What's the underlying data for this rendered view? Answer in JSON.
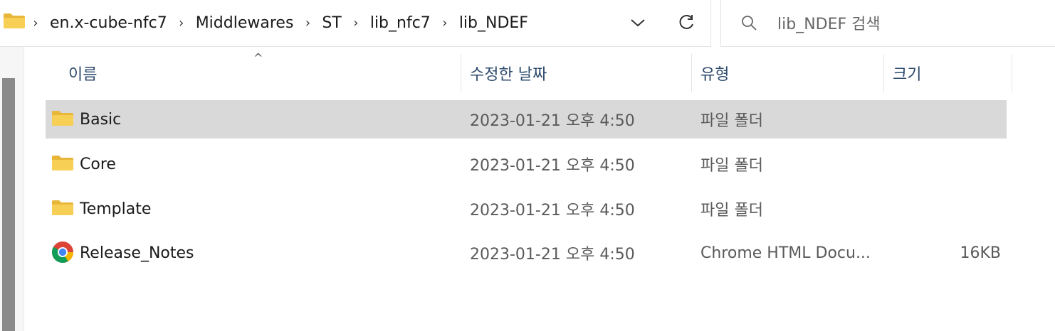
{
  "breadcrumb": [
    "en.x-cube-nfc7",
    "Middlewares",
    "ST",
    "lib_nfc7",
    "lib_NDEF"
  ],
  "search": {
    "placeholder": "lib_NDEF 검색"
  },
  "columns": {
    "name": "이름",
    "date": "수정한 날짜",
    "type": "유형",
    "size": "크기"
  },
  "files": [
    {
      "name": "Basic",
      "date": "2023-01-21 오후 4:50",
      "type": "파일 폴더",
      "size": "",
      "icon": "folder-icon",
      "selected": true
    },
    {
      "name": "Core",
      "date": "2023-01-21 오후 4:50",
      "type": "파일 폴더",
      "size": "",
      "icon": "folder-icon",
      "selected": false
    },
    {
      "name": "Template",
      "date": "2023-01-21 오후 4:50",
      "type": "파일 폴더",
      "size": "",
      "icon": "folder-icon",
      "selected": false
    },
    {
      "name": "Release_Notes",
      "date": "2023-01-21 오후 4:50",
      "type": "Chrome HTML Docu...",
      "size": "16KB",
      "icon": "chrome-icon",
      "selected": false
    }
  ],
  "colors": {
    "selection": "#d9d9d9",
    "folder": "#f5c84c",
    "header_text": "#2d4a6b"
  }
}
